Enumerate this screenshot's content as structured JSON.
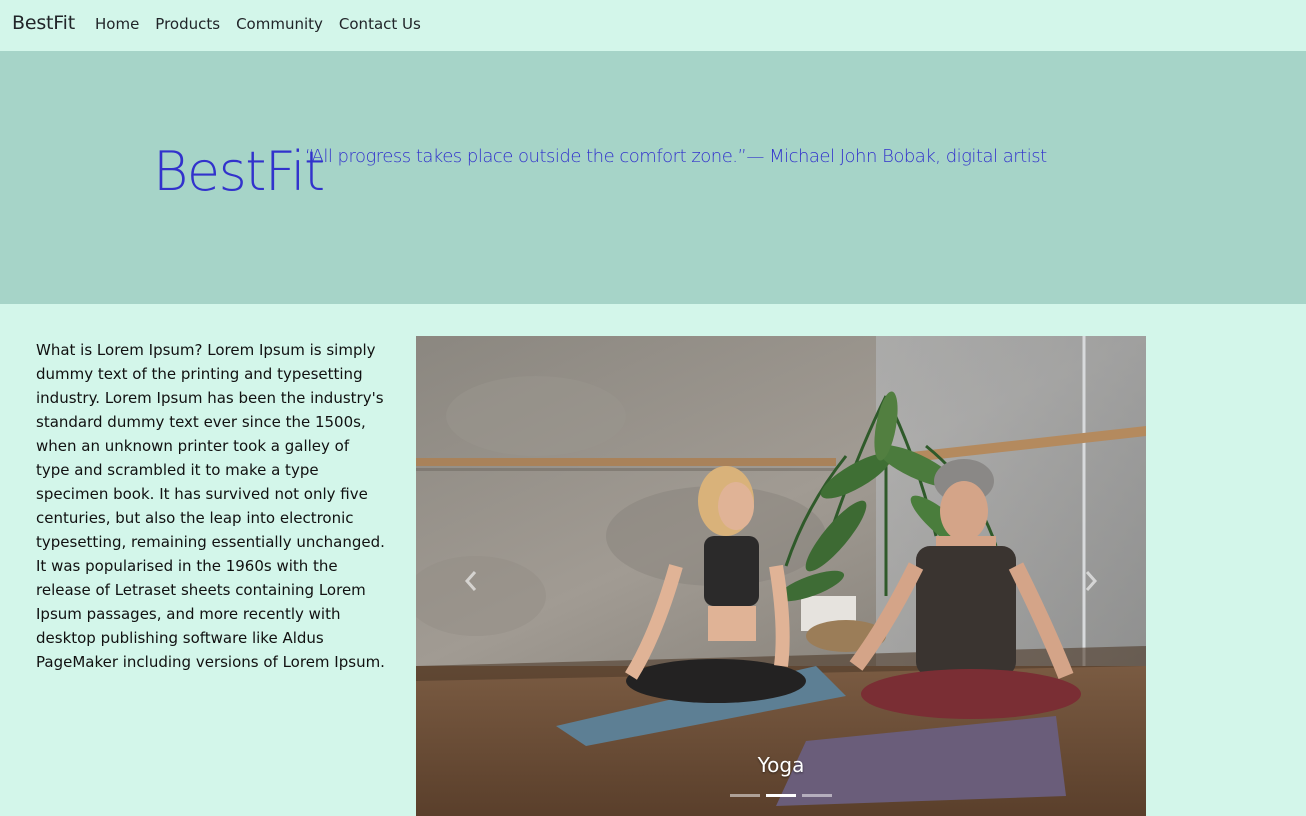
{
  "navbar": {
    "brand": "BestFit",
    "links": [
      "Home",
      "Products",
      "Community",
      "Contact Us"
    ]
  },
  "hero": {
    "title": "BestFit",
    "quote": "“All progress takes place outside the comfort zone.”— Michael John Bobak, digital artist"
  },
  "content": {
    "paragraph": "What is Lorem Ipsum? Lorem Ipsum is simply dummy text of the printing and typesetting industry. Lorem Ipsum has been the industry's standard dummy text ever since the 1500s, when an unknown printer took a galley of type and scrambled it to make a type specimen book. It has survived not only five centuries, but also the leap into electronic typesetting, remaining essentially unchanged. It was popularised in the 1960s with the release of Letraset sheets containing Lorem Ipsum passages, and more recently with desktop publishing software like Aldus PageMaker including versions of Lorem Ipsum."
  },
  "carousel": {
    "caption": "Yoga",
    "slide_count": 3,
    "active_index": 1,
    "prev_icon": "chevron-left-icon",
    "next_icon": "chevron-right-icon"
  },
  "colors": {
    "page_bg": "#d3f6ea",
    "hero_bg": "#a6d4c8",
    "hero_text": "#3232cc"
  }
}
